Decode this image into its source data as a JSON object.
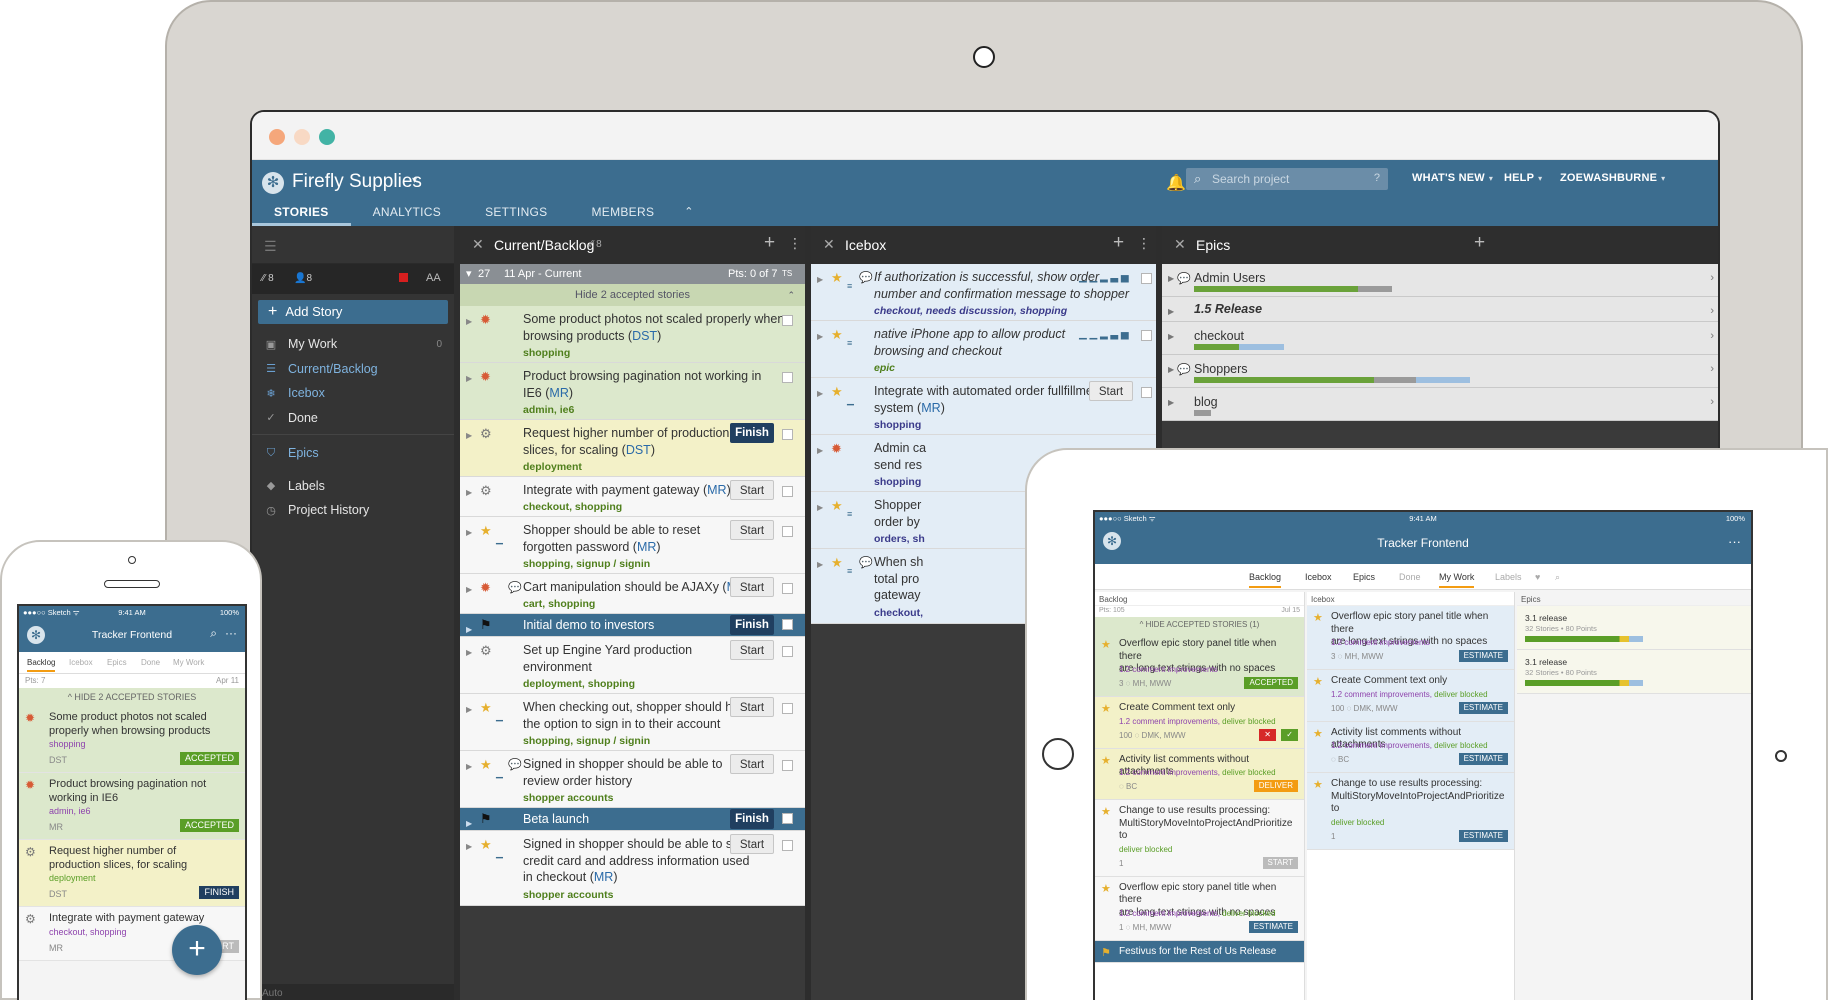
{
  "project": {
    "title": "Firefly Supplies",
    "caret": "▾"
  },
  "nav": {
    "tabs": [
      "STORIES",
      "ANALYTICS",
      "SETTINGS",
      "MEMBERS"
    ],
    "collapse": "⌃",
    "search_placeholder": "Search project",
    "search_help": "?",
    "whats_new": "WHAT'S NEW",
    "help": "HELP",
    "user": "ZOEWASHBURNE",
    "caret": "▾"
  },
  "colors": {
    "header": "#3c6d8f",
    "accepted": "#dce8cc",
    "started": "#f3f1c8",
    "release": "#3c6d8f",
    "label": "#4f7f1c"
  },
  "sidebar": {
    "velocity": "8",
    "members": "8",
    "font_icon": "AA",
    "add_story": "Add Story",
    "items": [
      {
        "label": "My Work",
        "count": "0",
        "icon": "inbox-icon"
      },
      {
        "label": "Current/Backlog",
        "icon": "list-icon"
      },
      {
        "label": "Icebox",
        "icon": "snowflake-icon"
      },
      {
        "label": "Done",
        "icon": "check-icon"
      }
    ],
    "items2": [
      {
        "label": "Epics",
        "icon": "shield-icon"
      },
      {
        "label": "Labels",
        "icon": "tag-icon"
      },
      {
        "label": "Project History",
        "icon": "clock-icon"
      }
    ],
    "bottom": "Auto"
  },
  "backlog": {
    "title": "Current/Backlog",
    "count": "8",
    "iteration": {
      "number": "27",
      "date": "11 Apr - Current",
      "points": "Pts: 0 of 7",
      "ts": "TS"
    },
    "hide_accepted": "Hide 2 accepted stories",
    "stories": [
      {
        "title1": "Some product photos not scaled properly when",
        "title2": "browsing products (",
        "code": "DST",
        "close": ")",
        "labels": "shopping"
      },
      {
        "title1": "Product browsing pagination not working in",
        "title2": "IE6 (",
        "code": "MR",
        "close": ")",
        "labels": "admin, ie6"
      },
      {
        "title1": "Request higher number of production",
        "title2": "slices, for scaling (",
        "code": "DST",
        "close": ")",
        "labels": "deployment",
        "button": "Finish"
      },
      {
        "title1": "Integrate with payment gateway (",
        "code": "MR",
        "close": ")",
        "labels": "checkout, shopping",
        "button": "Start"
      },
      {
        "title1": "Shopper should be able to reset",
        "title2": "forgotten password (",
        "code": "MR",
        "close": ")",
        "labels": "shopping, signup / signin",
        "button": "Start"
      },
      {
        "title1": "Cart manipulation should be AJAXy (",
        "code": "MR",
        "close": ")",
        "labels": "cart, shopping",
        "button": "Start"
      },
      {
        "title1": "Initial demo to investors",
        "button": "Finish"
      },
      {
        "title1": "Set up Engine Yard production",
        "title2": "environment",
        "labels": "deployment, shopping",
        "button": "Start"
      },
      {
        "title1": "When checking out, shopper should have",
        "title2": "the option to sign in to their account",
        "labels": "shopping, signup / signin",
        "button": "Start"
      },
      {
        "title1": "Signed in shopper should be able to",
        "title2": "review order history",
        "labels": "shopper accounts",
        "button": "Start"
      },
      {
        "title1": "Beta launch",
        "button": "Finish"
      },
      {
        "title1": "Signed in shopper should be able to save",
        "title2": "credit card and address information used",
        "title3": "in checkout (",
        "code": "MR",
        "close": ")",
        "labels": "shopper accounts",
        "button": "Start"
      }
    ]
  },
  "icebox": {
    "title": "Icebox",
    "stories": [
      {
        "title1": "If authorization is successful, show order",
        "title2": "number and confirmation message to shopper",
        "labels": "checkout, needs discussion, shopping"
      },
      {
        "title1": "native iPhone app to allow product",
        "title2": "browsing and checkout",
        "labels": "epic"
      },
      {
        "title1": "Integrate with automated order fullfillment",
        "title2": "system (",
        "code": "MR",
        "close": ")",
        "labels": "shopping",
        "button": "Start"
      },
      {
        "title1": "Admin ca",
        "title2": "send res",
        "labels": "shopping"
      },
      {
        "title1": "Shopper",
        "title2": "order by",
        "labels": "orders, sh"
      },
      {
        "title1": "When sh",
        "title2": "total pro",
        "title3": "gateway",
        "labels": "checkout,"
      }
    ]
  },
  "epics": {
    "title": "Epics",
    "items": [
      {
        "name": "Admin Users",
        "done": 0.58,
        "started": 0.12,
        "unstarted": 0
      },
      {
        "name": "1.5 Release"
      },
      {
        "name": "checkout",
        "done": 0.16,
        "started": 0,
        "unstarted": 0.16
      },
      {
        "name": "Shoppers",
        "done": 0.64,
        "started": 0.15,
        "unstarted": 0.19
      },
      {
        "name": "blog",
        "done": 0,
        "started": 0.06,
        "unstarted": 0
      }
    ]
  },
  "tablet": {
    "status_left": "●●●○○ Sketch ᯤ",
    "status_time": "9:41 AM",
    "status_right": "100%",
    "title": "Tracker Frontend",
    "more": "···",
    "tabs": [
      "Backlog",
      "Icebox",
      "Epics",
      "Done",
      "My Work",
      "Labels"
    ],
    "backlog_head": "Backlog",
    "backlog_pts": "Pts: 105",
    "backlog_date": "Jul 15",
    "hide_accepted": "^ HIDE ACCEPTED STORIES (1)",
    "icebox_head": "Icebox",
    "epics_head": "Epics",
    "backlog_cards": [
      {
        "t1": "Overflow epic story panel title when there",
        "t2": "are long text strings with no spaces",
        "lab": "1.2 comment improvements",
        "pt": "3",
        "who": "MH, MWW",
        "btn": "ACCEPTED"
      },
      {
        "t1": "Create Comment text only",
        "lab": "1.2 comment improvements,",
        "lab2": "deliver blocked",
        "pt": "100",
        "who": "DMK, MWW"
      },
      {
        "t1": "Activity list comments without attachments",
        "lab": "1.2 comment improvements,",
        "lab2": "deliver blocked",
        "who": "BC",
        "btn": "DELIVER"
      },
      {
        "t1": "Change to use results processing:",
        "t2": "MultiStoryMoveIntoProjectAndPrioritize",
        "t3": "to",
        "lab2": "deliver blocked",
        "pt": "1",
        "btn": "START"
      },
      {
        "t1": "Overflow epic story panel title when there",
        "t2": "are long text strings with no spaces",
        "lab": "1.2 comment improvements,",
        "lab2": "deliver blocked",
        "pt": "1",
        "who": "MH, MWW",
        "btn": "ESTIMATE"
      },
      {
        "t1": "Festivus for the Rest of Us Release"
      }
    ],
    "icebox_cards": [
      {
        "t1": "Overflow epic story panel title when there",
        "t2": "are long text strings with no spaces",
        "lab": "1.2 comment improvements",
        "pt": "3",
        "who": "MH, MWW",
        "btn": "ESTIMATE"
      },
      {
        "t1": "Create Comment text only",
        "lab": "1.2 comment improvements,",
        "lab2": "deliver blocked",
        "pt": "100",
        "who": "DMK, MWW",
        "btn": "ESTIMATE"
      },
      {
        "t1": "Activity list comments without attachments",
        "lab": "1.2 comment improvements,",
        "lab2": "deliver blocked",
        "who": "BC",
        "btn": "ESTIMATE"
      },
      {
        "t1": "Change to use results processing:",
        "t2": "MultiStoryMoveIntoProjectAndPrioritize",
        "t3": "to",
        "lab2": "deliver blocked",
        "pt": "1",
        "btn": "ESTIMATE"
      }
    ],
    "epic_cards": [
      {
        "name": "3.1 release",
        "meta": "32 Stories • 80 Points"
      },
      {
        "name": "3.1 release",
        "meta": "32 Stories • 80 Points"
      }
    ]
  },
  "phone": {
    "status_left": "●●●○○ Sketch ᯤ",
    "status_time": "9:41 AM",
    "status_right": "100%",
    "title": "Tracker Frontend",
    "tabs": [
      "Backlog",
      "Icebox",
      "Epics",
      "Done",
      "My Work"
    ],
    "pts": "Pts: 7",
    "date": "Apr 11",
    "hide_accepted": "^ HIDE 2 ACCEPTED STORIES",
    "cards": [
      {
        "t1": "Some product photos not scaled",
        "t2": "properly when browsing products",
        "lab": "shopping",
        "who": "DST",
        "btn": "ACCEPTED"
      },
      {
        "t1": "Product browsing pagination not",
        "t2": "working in IE6",
        "lab": "admin, ie6",
        "who": "MR",
        "btn": "ACCEPTED"
      },
      {
        "t1": "Request higher number of",
        "t2": "production slices, for scaling",
        "lab": "deployment",
        "who": "DST",
        "btn": "FINISH"
      },
      {
        "t1": "Integrate with payment gateway",
        "lab": "checkout, shopping",
        "who": "MR",
        "btn": "START"
      }
    ],
    "fab": "+"
  }
}
